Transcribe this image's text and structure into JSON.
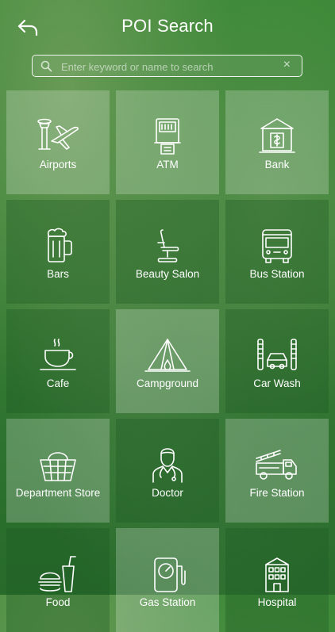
{
  "header": {
    "title": "POI Search"
  },
  "search": {
    "placeholder": "Enter keyword or name to search",
    "value": "",
    "clear_glyph": "×"
  },
  "icons": {
    "back": "back-arrow-icon",
    "search": "search-icon"
  },
  "categories": [
    {
      "label": "Airports",
      "icon": "airport-icon"
    },
    {
      "label": "ATM",
      "icon": "atm-icon"
    },
    {
      "label": "Bank",
      "icon": "bank-icon"
    },
    {
      "label": "Bars",
      "icon": "beer-mug-icon"
    },
    {
      "label": "Beauty Salon",
      "icon": "salon-chair-icon"
    },
    {
      "label": "Bus Station",
      "icon": "bus-icon"
    },
    {
      "label": "Cafe",
      "icon": "coffee-cup-icon"
    },
    {
      "label": "Campground",
      "icon": "tent-icon"
    },
    {
      "label": "Car Wash",
      "icon": "car-wash-icon"
    },
    {
      "label": "Department Store",
      "icon": "basket-icon"
    },
    {
      "label": "Doctor",
      "icon": "doctor-icon"
    },
    {
      "label": "Fire Station",
      "icon": "fire-truck-icon"
    },
    {
      "label": "Food",
      "icon": "food-icon"
    },
    {
      "label": "Gas Station",
      "icon": "gas-pump-icon"
    },
    {
      "label": "Hospital",
      "icon": "hospital-icon"
    }
  ]
}
